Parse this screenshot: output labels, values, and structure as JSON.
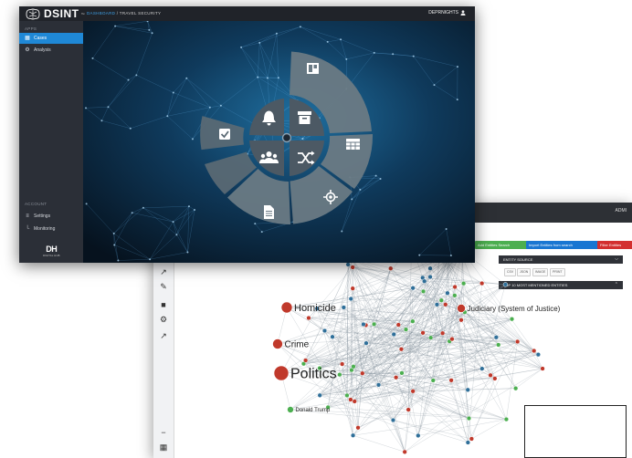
{
  "front": {
    "logo_text": "DSINT",
    "logo_sub": "™",
    "breadcrumb_home": "DASHBOARD",
    "breadcrumb_page": "/ TRAVEL SECURITY",
    "user_label": "DEPRNIGHTS",
    "apps_label": "APPS",
    "nav_items": [
      {
        "label": "Cases",
        "icon": "grid-icon",
        "active": true
      },
      {
        "label": "Analysis",
        "icon": "gear-icon",
        "active": false
      }
    ],
    "account_label": "ACCOUNT",
    "account_items": [
      {
        "label": "Settings",
        "icon": "sliders-icon"
      },
      {
        "label": "Monitoring",
        "icon": "chart-icon"
      }
    ],
    "dh_big": "DH",
    "dh_small": "DIGITAL HUB",
    "radial_menu": {
      "inner": [
        "bell-icon",
        "archive-icon",
        "users-icon",
        "shuffle-icon"
      ],
      "outer": [
        "checkbox-icon",
        "document-icon",
        "crosshair-icon",
        "table-icon",
        "columns-icon"
      ]
    }
  },
  "back": {
    "user_label": "ADMI",
    "tag_buttons": [
      {
        "label": "Add Entities Search",
        "color": "#4caf50"
      },
      {
        "label": "Import Entities from search",
        "color": "#1976d2"
      },
      {
        "label": "Filter Entities",
        "color": "#d32f2f"
      }
    ],
    "panel_bars": [
      "ENTITY SOURCE",
      "TOP 10 MOST MENTIONED ENTITIES"
    ],
    "mini_buttons": [
      "CSV",
      "JSON",
      "IMAGE",
      "PRINT"
    ],
    "graph_labels": [
      {
        "text": "Homicide",
        "size": 11
      },
      {
        "text": "Judiciary (System of Justice)",
        "size": 8
      },
      {
        "text": "Crime",
        "size": 10
      },
      {
        "text": "Politics",
        "size": 16
      },
      {
        "text": "Donald Trump",
        "size": 6
      }
    ],
    "colors": {
      "red_node": "#c0392b",
      "green_node": "#4caf50",
      "blue_node": "#2f6f99"
    }
  }
}
